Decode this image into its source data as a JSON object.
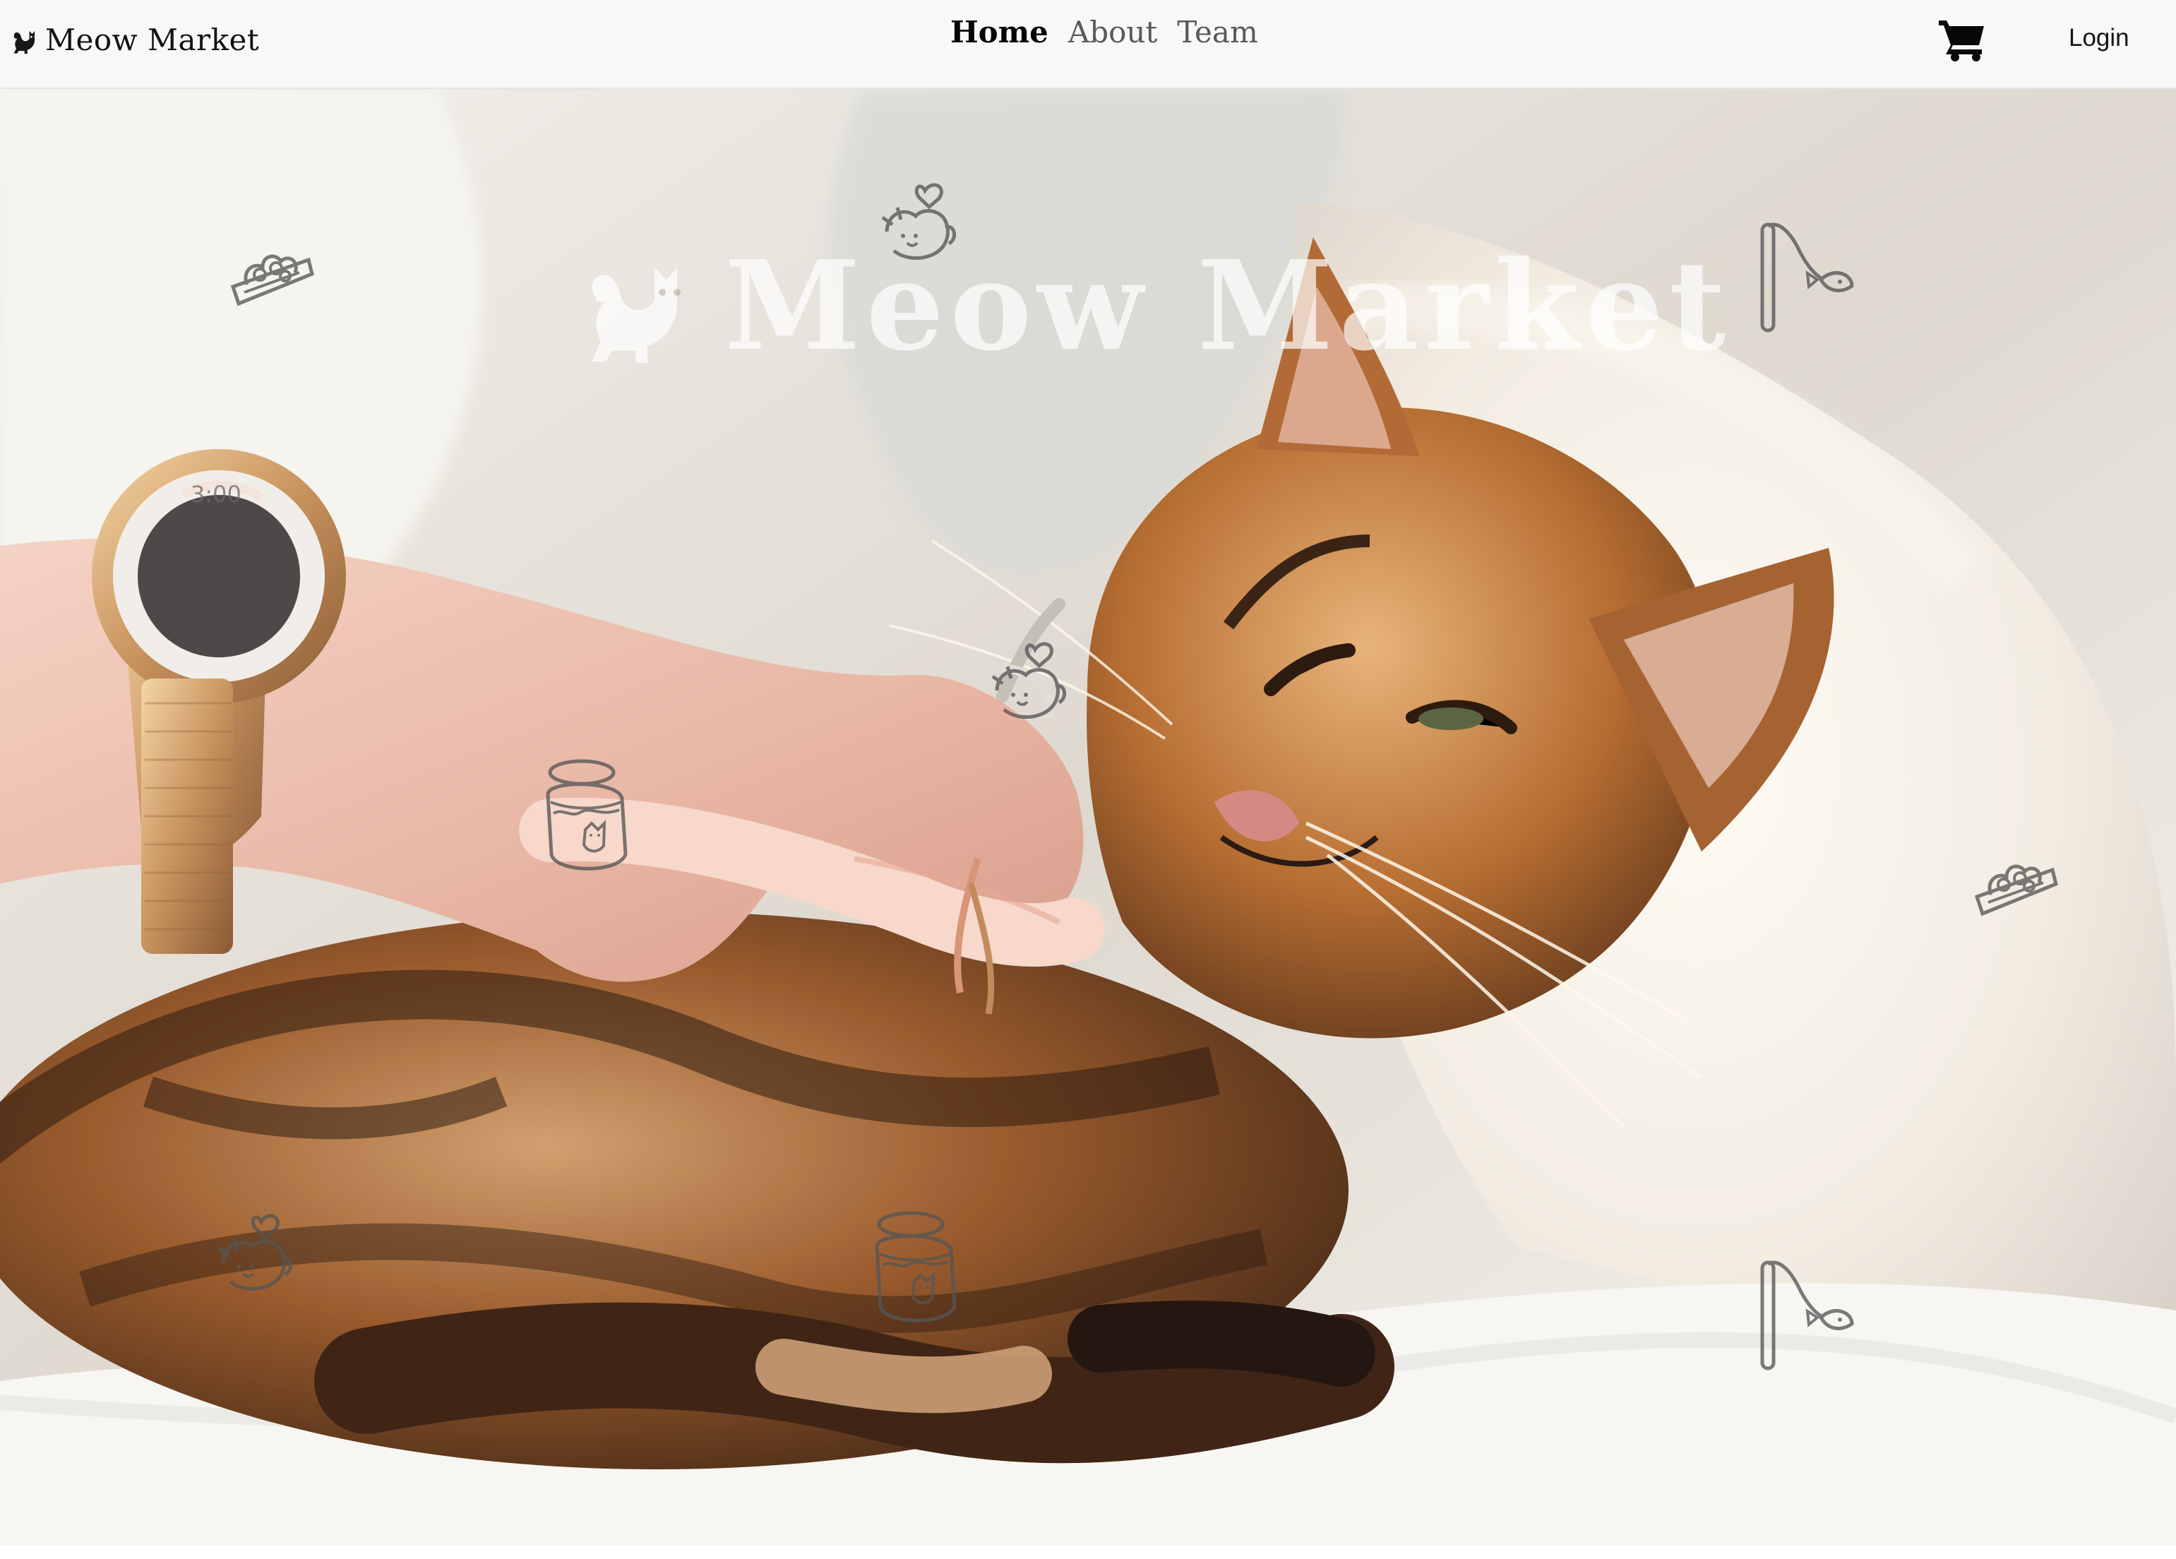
{
  "brand": {
    "name": "Meow Market",
    "icon": "cat-icon"
  },
  "navigation": {
    "links": [
      {
        "label": "Home",
        "active": true
      },
      {
        "label": "About",
        "active": false
      },
      {
        "label": "Team",
        "active": false
      }
    ],
    "cart_icon": "shopping-cart-icon",
    "login_label": "Login"
  },
  "hero": {
    "title": "Meow Market",
    "logo_icon": "cat-icon",
    "photo_subject": "woman scratching a Bengal cat under the chin",
    "doodles": [
      "cat-food-bowl-icon",
      "cat-heart-icon",
      "fishing-rod-toy-icon",
      "cat-food-can-icon"
    ]
  },
  "colors": {
    "nav_background": "#f7f8fa",
    "nav_text": "#595959",
    "active_text": "#050505",
    "overlay_text": "#ffffff"
  }
}
